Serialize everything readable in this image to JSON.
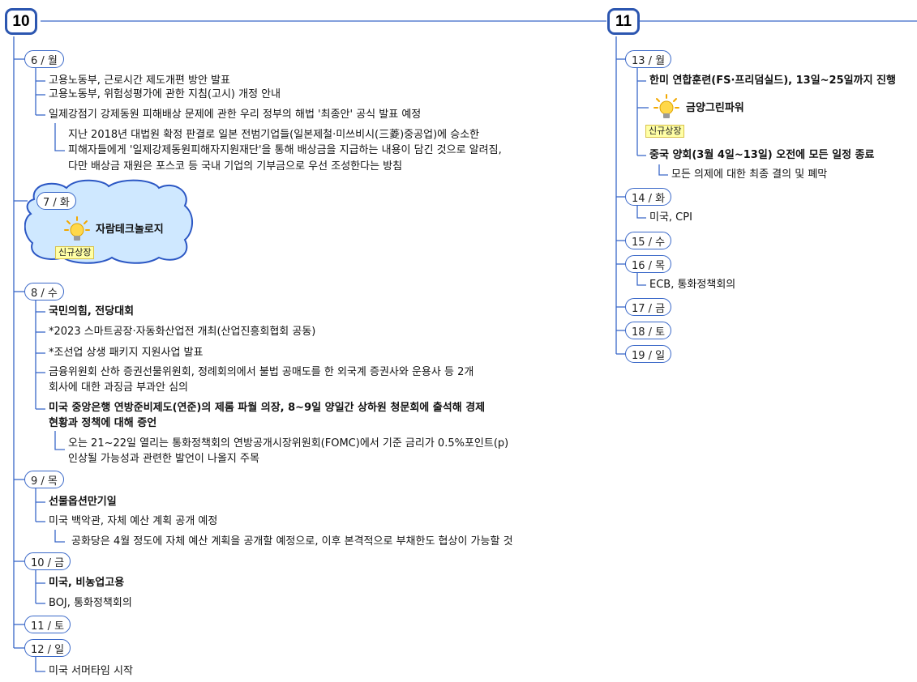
{
  "week10": {
    "label": "10",
    "d6": {
      "label": "6 / 월",
      "i1": "고용노동부, 근로시간 제도개편 방안 발표",
      "i2": "고용노동부, 위험성평가에 관한 지침(고시) 개정 안내",
      "i3": "일제강점기 강제동원 피해배상 문제에 관한 우리 정부의 해법 '최종안' 공식 발표 예정",
      "s1": "지난 2018년 대법원 확정 판결로 일본 전범기업들(일본제철·미쓰비시(三菱)중공업)에 승소한",
      "s2": "피해자들에게 '일제강제동원피해자지원재단'을 통해 배상금을 지급하는 내용이 담긴 것으로 알려짐,",
      "s3": "다만 배상금 재원은 포스코 등 국내 기업의 기부금으로 우선 조성한다는 방침"
    },
    "d7": {
      "label": "7 / 화",
      "i1": "자람테크놀로지",
      "badge": "신규상장"
    },
    "d8": {
      "label": "8 / 수",
      "i1": "국민의힘, 전당대회",
      "i2": "*2023 스마트공장·자동화산업전 개최(산업진흥회협회 공동)",
      "i3": "*조선업 상생 패키지 지원사업 발표",
      "i4a": "금융위원회 산하 증권선물위원회, 정례회의에서 불법 공매도를 한 외국계 증권사와 운용사 등 2개",
      "i4b": "회사에 대한 과징금 부과안 심의",
      "i5a": "미국 중앙은행 연방준비제도(연준)의 제롬 파월 의장, 8~9일 양일간 상하원 청문회에 출석해 경제",
      "i5b": "현황과 정책에 대해 증언",
      "s1": "오는 21~22일 열리는 통화정책회의 연방공개시장위원회(FOMC)에서 기준 금리가 0.5%포인트(p)",
      "s2": "인상될 가능성과 관련한 발언이 나올지 주목"
    },
    "d9": {
      "label": "9 / 목",
      "i1": "선물옵션만기일",
      "i2": "미국 백악관, 자체 예산 계획 공개 예정",
      "s1": "공화당은 4월 정도에 자체 예산 계획을 공개할 예정으로, 이후 본격적으로 부채한도 협상이 가능할 것"
    },
    "d10": {
      "label": "10 / 금",
      "i1": "미국, 비농업고용",
      "i2": "BOJ, 통화정책회의"
    },
    "d11": {
      "label": "11 / 토"
    },
    "d12": {
      "label": "12 / 일",
      "i1": "미국 서머타임 시작"
    }
  },
  "week11": {
    "label": "11",
    "d13": {
      "label": "13 / 월",
      "i1": "한미 연합훈련(FS·프리덤실드), 13일~25일까지 진행",
      "i2": "금양그린파워",
      "badge": "신규상장",
      "i3": "중국 양회(3월 4일~13일) 오전에 모든 일정 종료",
      "s1": "모든 의제에 대한 최종 결의 및 폐막"
    },
    "d14": {
      "label": "14 / 화",
      "i1": "미국, CPI"
    },
    "d15": {
      "label": "15 / 수"
    },
    "d16": {
      "label": "16 / 목",
      "i1": "ECB, 통화정책회의"
    },
    "d17": {
      "label": "17 / 금"
    },
    "d18": {
      "label": "18 / 토"
    },
    "d19": {
      "label": "19 / 일"
    }
  },
  "colors": {
    "line": "#3a68c8",
    "week_border": "#2c56b0",
    "cloud_fill": "#cfe8ff",
    "cloud_border": "#2b57c4",
    "badge_bg": "#ffffa6"
  },
  "icons": [
    "lightbulb-icon"
  ]
}
